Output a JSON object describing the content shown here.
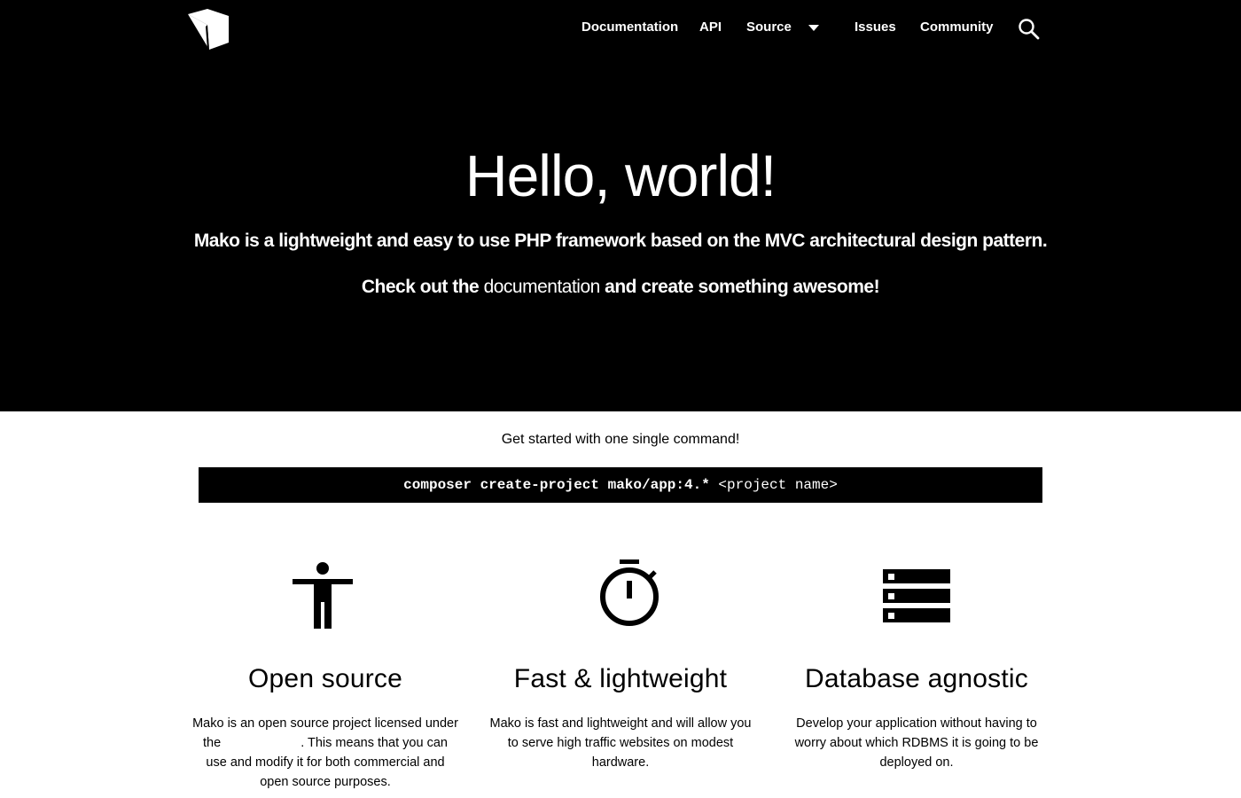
{
  "colors": {
    "hero_background": "#000000",
    "page_background": "#ffffff",
    "text_on_dark": "#ffffff",
    "command_background": "#000000"
  },
  "header": {
    "logo_icon": "cube-logo-icon",
    "nav": {
      "documentation": "Documentation",
      "api": "API",
      "source": "Source",
      "issues": "Issues",
      "community": "Community"
    },
    "source_dropdown_icon": "caret-down-icon",
    "search_icon": "search-icon"
  },
  "hero": {
    "title": "Hello, world!",
    "tagline": "Mako is a lightweight and easy to use PHP framework based on the MVC architectural design pattern.",
    "cta_before": "Check out the ",
    "cta_link": "documentation",
    "cta_after": " and create something awesome!"
  },
  "get_started": {
    "text": "Get started with one single command!",
    "command": "composer create-project mako/app:4.*",
    "command_arg": " <project name>"
  },
  "features": [
    {
      "icon": "accessibility-person-icon",
      "title": "Open source",
      "description_before": "Mako is an open source project licensed under the ",
      "description_after": ". This means that you can use and modify it for both commercial and open source purposes."
    },
    {
      "icon": "stopwatch-icon",
      "title": "Fast & lightweight",
      "description": "Mako is fast and lightweight and will allow you to serve high traffic websites on modest hardware."
    },
    {
      "icon": "database-servers-icon",
      "title": "Database agnostic",
      "description": "Develop your application without having to worry about which RDBMS it is going to be deployed on."
    }
  ]
}
